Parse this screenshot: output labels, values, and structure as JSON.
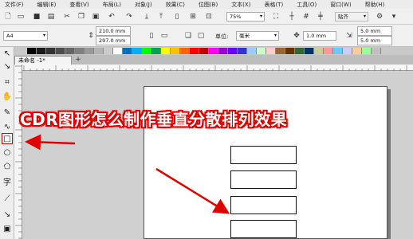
{
  "menubar": {
    "items": [
      "文件(F)",
      "编辑(E)",
      "查看(V)",
      "布局(L)",
      "对象(J)",
      "效果(C)",
      "位图(B)",
      "文本(X)",
      "表格(T)",
      "工具(O)",
      "窗口(W)",
      "帮助(H)"
    ]
  },
  "toolbar1": {
    "zoom_value": "75%",
    "snap_label": "贴齐"
  },
  "toolbar2": {
    "page_size": "A4",
    "width_value": "210.0 mm",
    "height_value": "297.0 mm",
    "units_label": "单位:",
    "units_value": "毫米",
    "nudge_value": "1.0 mm",
    "dup_x_value": "5.0 mm",
    "dup_y_value": "5.0 mm"
  },
  "document": {
    "tab_label": "未命名 -1*",
    "add_tab_symbol": "+"
  },
  "overlay": {
    "title": "CDR图形怎么制作垂直分散排列效果"
  },
  "colors": {
    "accent": "#e00000",
    "palette": [
      "#000000",
      "#1a1a1a",
      "#333333",
      "#4d4d4d",
      "#666666",
      "#808080",
      "#999999",
      "#b3b3b3",
      "#cccccc",
      "#ffffff",
      "#0070c0",
      "#00b0f0",
      "#00ff00",
      "#00a050",
      "#ffff00",
      "#ffc000",
      "#ff6600",
      "#ff0000",
      "#c00000",
      "#ff00ff",
      "#9900cc",
      "#6600ff",
      "#3333cc",
      "#99ccff",
      "#ccffcc",
      "#ffcccc",
      "#996633",
      "#663300",
      "#336633",
      "#003366",
      "#cccc99",
      "#ff9999",
      "#66ccff",
      "#ccccff",
      "#ffcc99",
      "#99ff99",
      "#c0c0c0"
    ]
  },
  "icons": {
    "tools": [
      "pick-tool-icon",
      "shape-tool-icon",
      "crop-tool-icon",
      "pan-tool-icon",
      "freehand-tool-icon",
      "artistic-media-icon",
      "rectangle-tool-icon",
      "ellipse-tool-icon",
      "polygon-tool-icon",
      "text-tool-icon",
      "parallel-dimension-icon",
      "connector-tool-icon",
      "drop-shadow-icon"
    ]
  }
}
